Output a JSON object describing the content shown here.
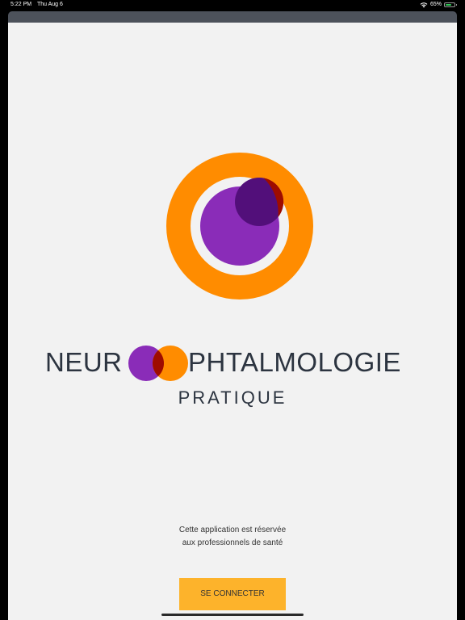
{
  "status_bar": {
    "time": "5:22 PM",
    "date": "Thu Aug 6",
    "battery": "65%",
    "battery_level": 0.65,
    "wifi_icon": "wifi-icon",
    "battery_icon": "battery-charging-icon"
  },
  "logo": {
    "wordmark_left": "NEUR",
    "wordmark_right": "PHTALMOLOGIE",
    "subtitle": "PRATIQUE",
    "colors": {
      "orange": "#ff8c00",
      "purple": "#8a2cb8",
      "dark_purple": "#520f7a",
      "overlap": "#9e0c00"
    }
  },
  "notice": {
    "line1": "Cette application est réservée",
    "line2": "aux professionnels de santé"
  },
  "login": {
    "label": "SE CONNECTER",
    "color": "#fdb32b"
  }
}
